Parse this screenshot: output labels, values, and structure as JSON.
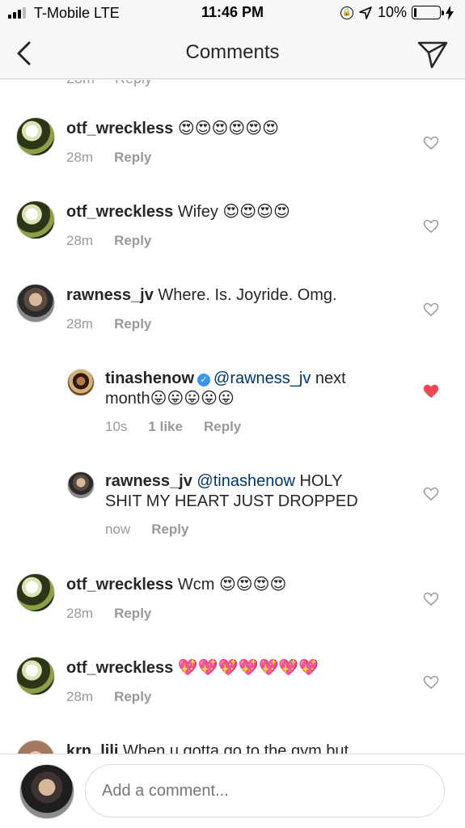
{
  "status_bar": {
    "carrier": "T-Mobile  LTE",
    "time": "11:46 PM",
    "battery": "10%",
    "battery_level": 0.1,
    "icons": [
      "signal-icon",
      "orientation-lock-icon",
      "location-arrow-icon",
      "battery-icon",
      "charging-bolt-icon"
    ]
  },
  "header": {
    "title": "Comments",
    "back_icon": "chevron-left-icon",
    "send_icon": "paper-plane-icon"
  },
  "comments": [
    {
      "user": "otf_wreckless",
      "text": "😍😍😍😍😍😍",
      "time": "28m",
      "reply": "Reply",
      "liked": false,
      "avatar": "otf"
    },
    {
      "user": "otf_wreckless",
      "text": "Wifey 😍😍😍😍",
      "time": "28m",
      "reply": "Reply",
      "liked": false,
      "avatar": "otf"
    },
    {
      "user": "rawness_jv",
      "text": "Where. Is. Joyride. Omg.",
      "time": "28m",
      "reply": "Reply",
      "liked": false,
      "avatar": "raw"
    },
    {
      "user": "tinashenow",
      "verified": true,
      "mention": "@rawness_jv",
      "text_line1": "next",
      "text_line2": "month😛😛😛😛😛",
      "time": "10s",
      "likes": "1 like",
      "reply": "Reply",
      "liked": true,
      "avatar": "tina"
    },
    {
      "user": "rawness_jv",
      "mention": "@tinashenow",
      "text_line1": "HOLY",
      "text_line2": "SHIT MY HEART JUST DROPPED",
      "time": "now",
      "reply": "Reply",
      "liked": false,
      "avatar": "raw"
    },
    {
      "user": "otf_wreckless",
      "text": "Wcm 😍😍😍😍",
      "time": "28m",
      "reply": "Reply",
      "liked": false,
      "avatar": "otf"
    },
    {
      "user": "otf_wreckless",
      "text": "💖💖💖💖💖💖💖",
      "time": "28m",
      "reply": "Reply",
      "liked": false,
      "avatar": "otf"
    },
    {
      "user": "krn_lili",
      "text": "When u gotta go to the gym but",
      "avatar": "krn"
    }
  ],
  "composer": {
    "placeholder": "Add a comment..."
  },
  "colors": {
    "heart_liked": "#ed4956",
    "mention": "#003569",
    "verified": "#3897f0",
    "meta": "#999999"
  }
}
